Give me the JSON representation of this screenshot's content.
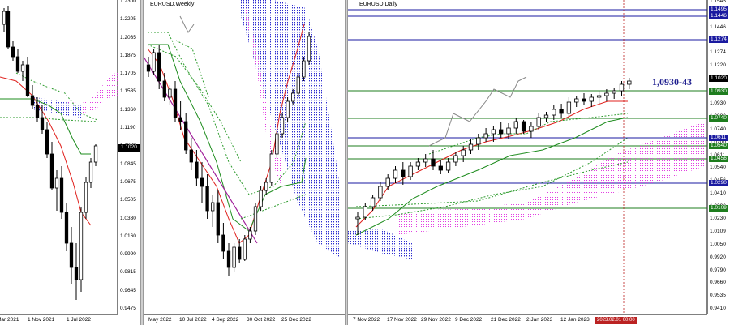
{
  "monthly": {
    "title": "",
    "ticks": [
      "1.2300",
      "1.2205",
      "1.2035",
      "1.1875",
      "1.1705",
      "1.1535",
      "1.1360",
      "1.1190",
      "1.1020",
      "1.0845",
      "1.0675",
      "1.0505",
      "1.0330",
      "1.0160",
      "0.9990",
      "0.9815",
      "0.9645",
      "0.9475"
    ],
    "current_price": "1.1020",
    "xlabels": [
      "Mar 2021",
      "1 Nov 2021",
      "1 Jul 2022"
    ]
  },
  "weekly": {
    "title": "EURUSD,Weekly",
    "xlabels": [
      "May 2022",
      "10 Jul 2022",
      "4 Sep 2022",
      "30 Oct 2022",
      "25 Dec 2022"
    ]
  },
  "daily": {
    "title": "EURUSD,Daily",
    "ticks": [
      "1.1545",
      "1.1495",
      "1.1446",
      "1.1395",
      "1.1274",
      "1.1220",
      "1.1100",
      "1.1020",
      "1.0930",
      "1.0880",
      "1.0740",
      "1.0700",
      "1.0611",
      "1.0540",
      "1.0456",
      "1.0410",
      "1.0290",
      "1.0230",
      "1.0109",
      "1.0050",
      "0.9920",
      "0.9790",
      "0.9660",
      "0.9535",
      "0.9410"
    ],
    "levels": [
      {
        "price": "1.1495",
        "bg": "#1a1aa0",
        "fg": "#ffffff"
      },
      {
        "price": "1.1446",
        "bg": "#1a1aa0",
        "fg": "#ffffff"
      },
      {
        "price": "1.1274",
        "bg": "#1a1aa0",
        "fg": "#ffffff"
      },
      {
        "price": "1.1020",
        "bg": "#000000",
        "fg": "#ffffff"
      },
      {
        "price": "1.0930",
        "bg": "#1e7d1e",
        "fg": "#ffffff"
      },
      {
        "price": "1.0740",
        "bg": "#1e7d1e",
        "fg": "#ffffff"
      },
      {
        "price": "1.0611",
        "bg": "#1a1aa0",
        "fg": "#ffffff"
      },
      {
        "price": "1.0540",
        "bg": "#1e7d1e",
        "fg": "#ffffff"
      },
      {
        "price": "1.0456",
        "bg": "#1e7d1e",
        "fg": "#ffffff"
      },
      {
        "price": "1.0290",
        "bg": "#1a1aa0",
        "fg": "#ffffff"
      },
      {
        "price": "1.0109",
        "bg": "#1e7d1e",
        "fg": "#ffffff"
      }
    ],
    "annotation": "1,0930-43",
    "xlabels": [
      "7 Nov 2022",
      "17 Nov 2022",
      "29 Nov 2022",
      "9 Dec 2022",
      "21 Dec 2022",
      "2 Jan 2023",
      "12 Jan 2023",
      "24"
    ],
    "date_marker": "2023.02.01 00:00"
  },
  "colors": {
    "bull": "#ffffff",
    "bear": "#000000",
    "tenkan": "#e0201c",
    "kijun": "#1e8c1e",
    "cloud_up": "#e23de2",
    "cloud_dn": "#2d2dcf"
  }
}
